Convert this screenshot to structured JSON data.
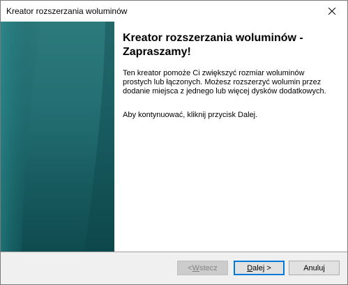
{
  "window": {
    "title": "Kreator rozszerzania woluminów",
    "close_icon": "close-icon"
  },
  "main": {
    "heading": "Kreator rozszerzania woluminów - Zapraszamy!",
    "description": "Ten kreator pomoże Ci zwiększyć rozmiar woluminów prostych lub łączonych. Możesz rozszerzyć wolumin przez dodanie miejsca z jednego lub więcej dysków dodatkowych.",
    "instruction": "Aby kontynuować, kliknij przycisk Dalej."
  },
  "buttons": {
    "back_prefix": "< ",
    "back_mnemonic": "W",
    "back_rest": "stecz",
    "next_mnemonic": "D",
    "next_rest": "alej >",
    "cancel_label": "Anuluj"
  },
  "colors": {
    "banner": "#17666a",
    "focus_border": "#0078d7",
    "footer_bg": "#f0f0f0"
  }
}
